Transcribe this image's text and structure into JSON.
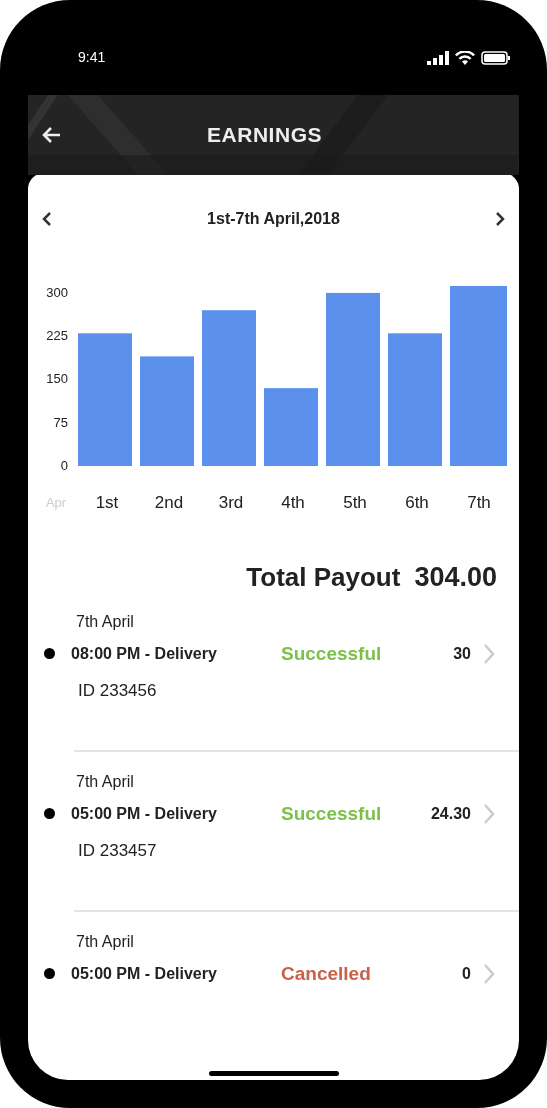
{
  "status_bar": {
    "time": "9:41"
  },
  "header": {
    "title": "EARNINGS"
  },
  "period": {
    "label": "1st-7th April,2018"
  },
  "chart_data": {
    "type": "bar",
    "xlabel": "Apr",
    "categories": [
      "1st",
      "2nd",
      "3rd",
      "4th",
      "5th",
      "6th",
      "7th"
    ],
    "values": [
      230,
      190,
      270,
      135,
      300,
      230,
      312
    ],
    "ylim": [
      0,
      312
    ],
    "yticks": [
      0,
      75,
      150,
      225,
      300
    ]
  },
  "total": {
    "label": "Total Payout",
    "amount": "304.00"
  },
  "transactions": [
    {
      "date": "7th April",
      "time": "08:00 PM - Delivery",
      "status": "Successful",
      "kind": "success",
      "amount": "30",
      "id": "ID 233456"
    },
    {
      "date": "7th April",
      "time": "05:00 PM - Delivery",
      "status": "Successful",
      "kind": "success",
      "amount": "24.30",
      "id": "ID 233457"
    },
    {
      "date": "7th April",
      "time": "05:00 PM - Delivery",
      "status": "Cancelled",
      "kind": "cancelled",
      "amount": "0"
    }
  ]
}
